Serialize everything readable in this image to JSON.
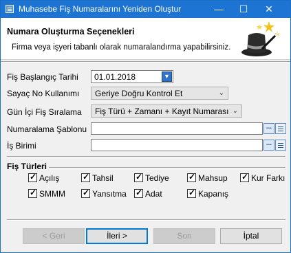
{
  "window": {
    "title": "Muhasebe Fiş Numaralarını Yeniden Oluştur",
    "minimize": "—",
    "maximize": "☐",
    "close": "✕"
  },
  "header": {
    "title": "Numara Oluşturma Seçenekleri",
    "subtitle": "Firma veya işyeri tabanlı olarak numaralandırma yapabilirsiniz.",
    "art_icon": "magic-hat-icon"
  },
  "form": {
    "start_date": {
      "label": "Fiş Başlangıç Tarihi",
      "value": "01.01.2018"
    },
    "serial_usage": {
      "label": "Sayaç No Kullanımı",
      "value": "Geriye Doğru Kontrol Et"
    },
    "daily_sort": {
      "label": "Gün İçi Fiş Sıralama",
      "value": "Fiş Türü + Zamanı + Kayıt Numarası"
    },
    "template": {
      "label": "Numaralama Şablonu",
      "value": ""
    },
    "unit": {
      "label": "İş Birimi",
      "value": ""
    },
    "dots_label": "...",
    "chevron": "⌄"
  },
  "fis_turleri": {
    "title": "Fiş Türleri",
    "items": [
      {
        "label": "Açılış",
        "checked": true
      },
      {
        "label": "Tahsil",
        "checked": true
      },
      {
        "label": "Tediye",
        "checked": true
      },
      {
        "label": "Mahsup",
        "checked": true
      },
      {
        "label": "Kur Farkı",
        "checked": true
      },
      {
        "label": "SMMM",
        "checked": true
      },
      {
        "label": "Yansıtma",
        "checked": true
      },
      {
        "label": "Adat",
        "checked": true
      },
      {
        "label": "Kapanış",
        "checked": true
      }
    ]
  },
  "buttons": {
    "back": "< Geri",
    "next": "İleri >",
    "finish": "Son",
    "cancel": "İptal"
  }
}
